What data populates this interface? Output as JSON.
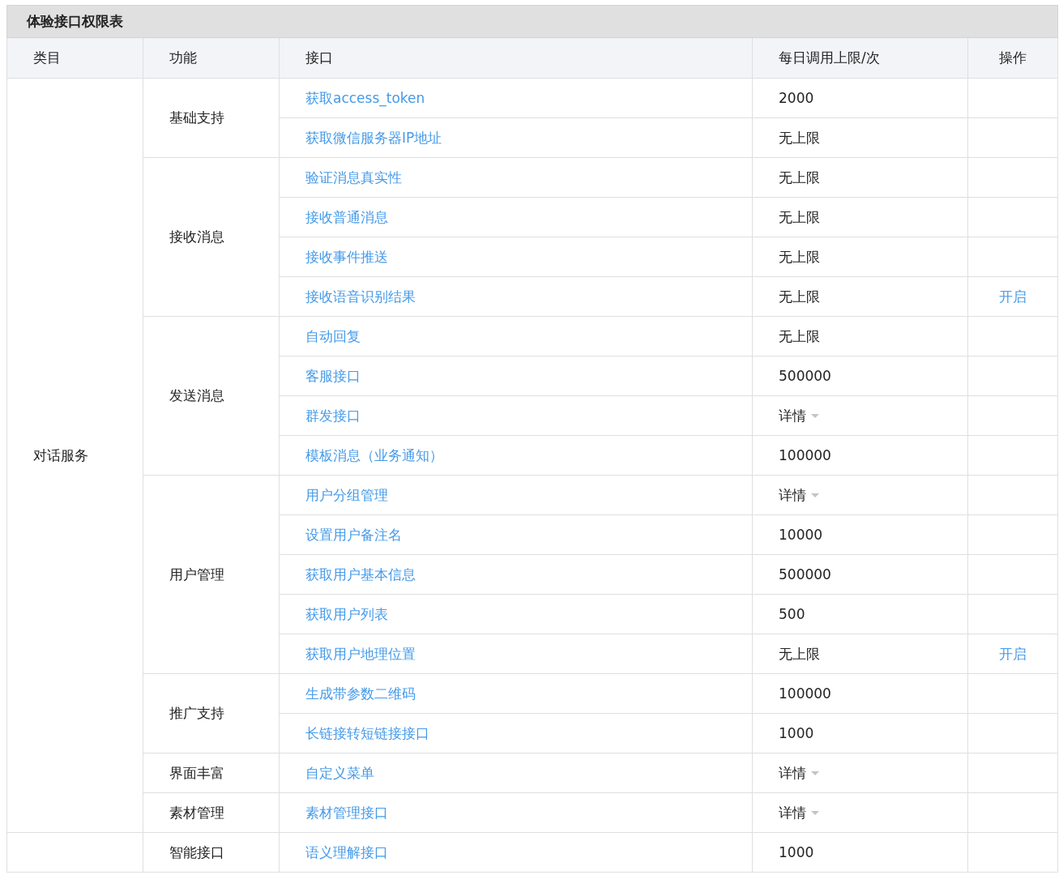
{
  "table": {
    "title": "体验接口权限表",
    "columns": [
      "类目",
      "功能",
      "接口",
      "每日调用上限/次",
      "操作"
    ],
    "categories": [
      {
        "name": "对话服务",
        "functions": [
          {
            "name": "基础支持",
            "apis": [
              {
                "name": "获取access_token",
                "limit": "2000",
                "kind": "text"
              },
              {
                "name": "获取微信服务器IP地址",
                "limit": "无上限",
                "kind": "text"
              }
            ]
          },
          {
            "name": "接收消息",
            "apis": [
              {
                "name": "验证消息真实性",
                "limit": "无上限",
                "kind": "text"
              },
              {
                "name": "接收普通消息",
                "limit": "无上限",
                "kind": "text"
              },
              {
                "name": "接收事件推送",
                "limit": "无上限",
                "kind": "text"
              },
              {
                "name": "接收语音识别结果",
                "limit": "无上限",
                "kind": "text",
                "action": "开启"
              }
            ]
          },
          {
            "name": "发送消息",
            "apis": [
              {
                "name": "自动回复",
                "limit": "无上限",
                "kind": "text"
              },
              {
                "name": "客服接口",
                "limit": "500000",
                "kind": "text"
              },
              {
                "name": "群发接口",
                "limit": "详情",
                "kind": "dropdown"
              },
              {
                "name": "模板消息（业务通知）",
                "limit": "100000",
                "kind": "text"
              }
            ]
          },
          {
            "name": "用户管理",
            "apis": [
              {
                "name": "用户分组管理",
                "limit": "详情",
                "kind": "dropdown"
              },
              {
                "name": "设置用户备注名",
                "limit": "10000",
                "kind": "text"
              },
              {
                "name": "获取用户基本信息",
                "limit": "500000",
                "kind": "text"
              },
              {
                "name": "获取用户列表",
                "limit": "500",
                "kind": "text"
              },
              {
                "name": "获取用户地理位置",
                "limit": "无上限",
                "kind": "text",
                "action": "开启"
              }
            ]
          },
          {
            "name": "推广支持",
            "apis": [
              {
                "name": "生成带参数二维码",
                "limit": "100000",
                "kind": "text"
              },
              {
                "name": "长链接转短链接接口",
                "limit": "1000",
                "kind": "text"
              }
            ]
          },
          {
            "name": "界面丰富",
            "apis": [
              {
                "name": "自定义菜单",
                "limit": "详情",
                "kind": "dropdown"
              }
            ]
          },
          {
            "name": "素材管理",
            "apis": [
              {
                "name": "素材管理接口",
                "limit": "详情",
                "kind": "dropdown"
              }
            ]
          }
        ]
      },
      {
        "functions": [
          {
            "name": "智能接口",
            "apis": [
              {
                "name": "语义理解接口",
                "limit": "1000",
                "kind": "text"
              }
            ]
          }
        ]
      }
    ]
  }
}
